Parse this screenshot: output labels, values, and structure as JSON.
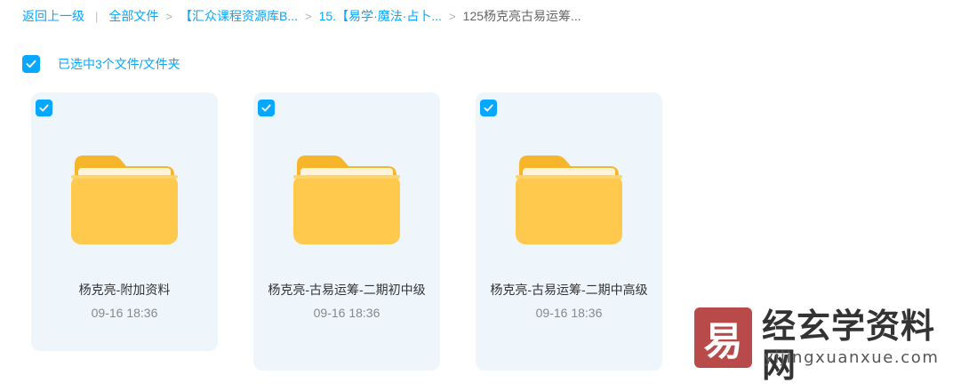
{
  "breadcrumb": {
    "back_label": "返回上一级",
    "items": [
      "全部文件",
      "【汇众课程资源库B...",
      "15.【易学·魔法·占卜...",
      "125杨克亮古易运筹..."
    ]
  },
  "selection": {
    "label": "已选中3个文件/文件夹",
    "checked": true
  },
  "files": [
    {
      "name": "杨克亮-附加资料",
      "date": "09-16 18:36",
      "checked": true
    },
    {
      "name": "杨克亮-古易运筹-二期初中级",
      "date": "09-16 18:36",
      "checked": true
    },
    {
      "name": "杨克亮-古易运筹-二期中高级",
      "date": "09-16 18:36",
      "checked": true
    }
  ],
  "watermark": {
    "logo_char": "易",
    "title": "经玄学资料网",
    "url": "yijingxuanxue.com"
  },
  "colors": {
    "accent": "#06a7ff",
    "card_bg": "#eef6fc",
    "folder_yellow": "#ffc94d"
  },
  "icons": [
    "check-icon",
    "folder-icon"
  ]
}
